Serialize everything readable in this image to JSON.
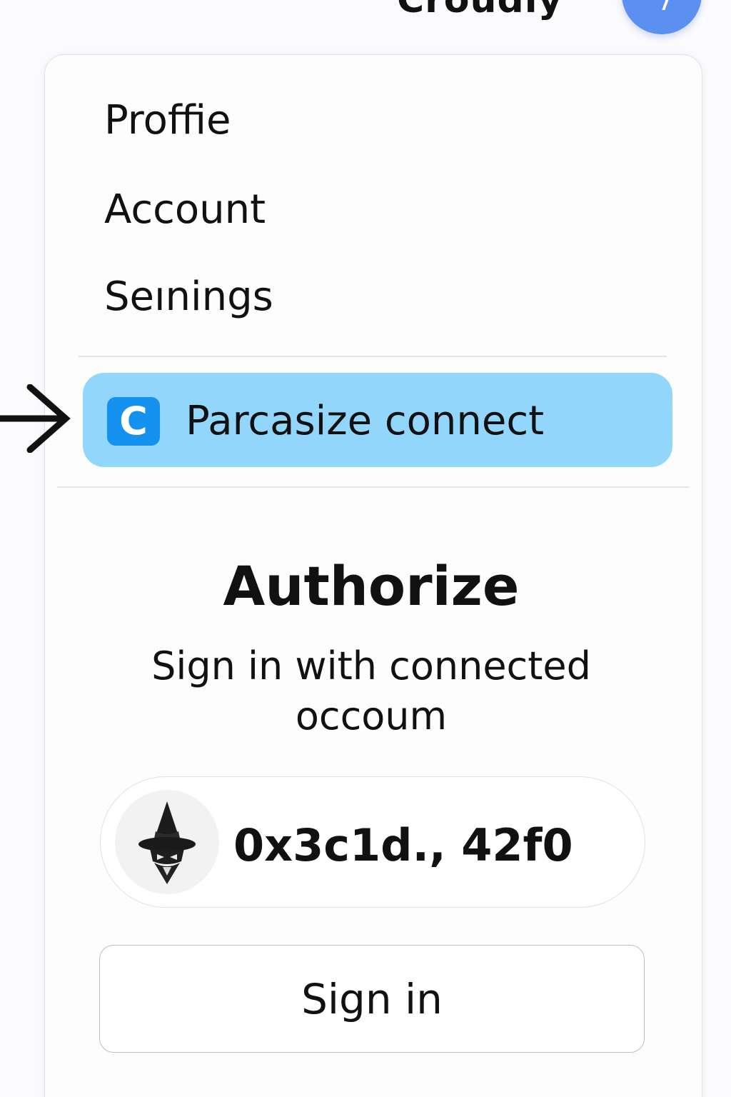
{
  "header": {
    "app_title": "Croudly",
    "avatar_icon": "user-avatar-icon",
    "avatar_color": "#5b8ff0"
  },
  "menu": {
    "items": [
      {
        "label": "Proffie"
      },
      {
        "label": "Account"
      },
      {
        "label": "Seınings"
      }
    ],
    "connect": {
      "logo_letter": "C",
      "label": "Parcasize connect",
      "highlight_color": "#92d6fb",
      "logo_color": "#1592f0"
    }
  },
  "authorize": {
    "title": "Authorize",
    "subtitle": "Sign in with connected occoum",
    "wallet": {
      "icon": "wizard-avatar-icon",
      "address": "0x3c1d., 42f0"
    },
    "signin_label": "Sign in"
  },
  "annotation": {
    "icon": "right-arrow-icon"
  }
}
